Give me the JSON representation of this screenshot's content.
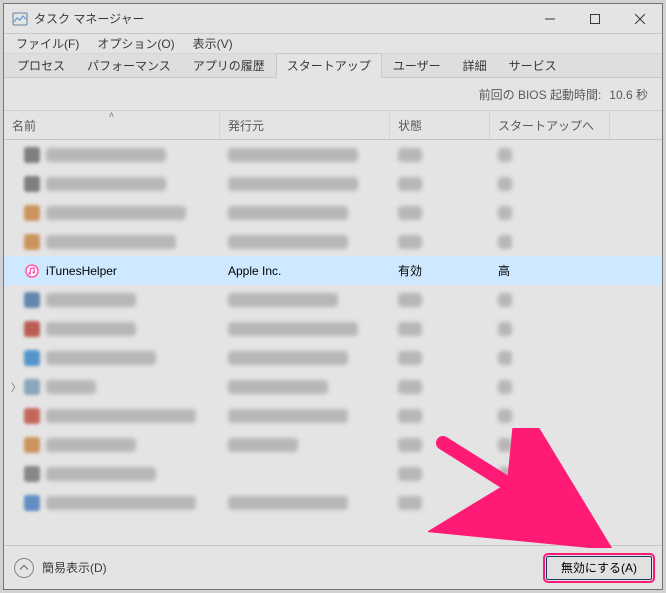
{
  "window": {
    "title": "タスク マネージャー"
  },
  "menubar": {
    "file": "ファイル(F)",
    "options": "オプション(O)",
    "view": "表示(V)"
  },
  "tabs": {
    "processes": "プロセス",
    "performance": "パフォーマンス",
    "app_history": "アプリの履歴",
    "startup": "スタートアップ",
    "users": "ユーザー",
    "details": "詳細",
    "services": "サービス"
  },
  "bios": {
    "label": "前回の BIOS 起動時間:",
    "value": "10.6 秒"
  },
  "columns": {
    "name": "名前",
    "publisher": "発行元",
    "status": "状態",
    "impact": "スタートアップへ"
  },
  "selected_row": {
    "name": "iTunesHelper",
    "publisher": "Apple Inc.",
    "status": "有効",
    "impact": "高"
  },
  "footer": {
    "fewer_details": "簡易表示(D)",
    "disable": "無効にする(A)"
  }
}
